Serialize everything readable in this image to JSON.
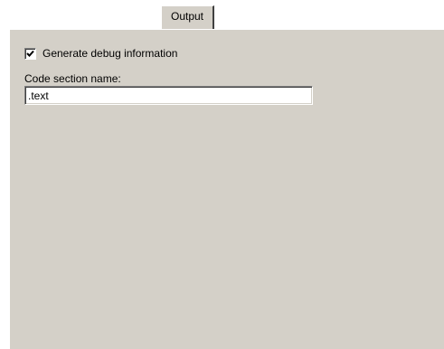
{
  "tabs": [
    {
      "label": "Output",
      "active": true
    }
  ],
  "output": {
    "debug_checkbox": {
      "label": "Generate debug information",
      "checked": true
    },
    "code_section": {
      "label": "Code section name:",
      "value": ".text"
    }
  },
  "colors": {
    "panel_background": "#d4d0c8",
    "page_background": "#ffffff",
    "field_background": "#ffffff"
  }
}
